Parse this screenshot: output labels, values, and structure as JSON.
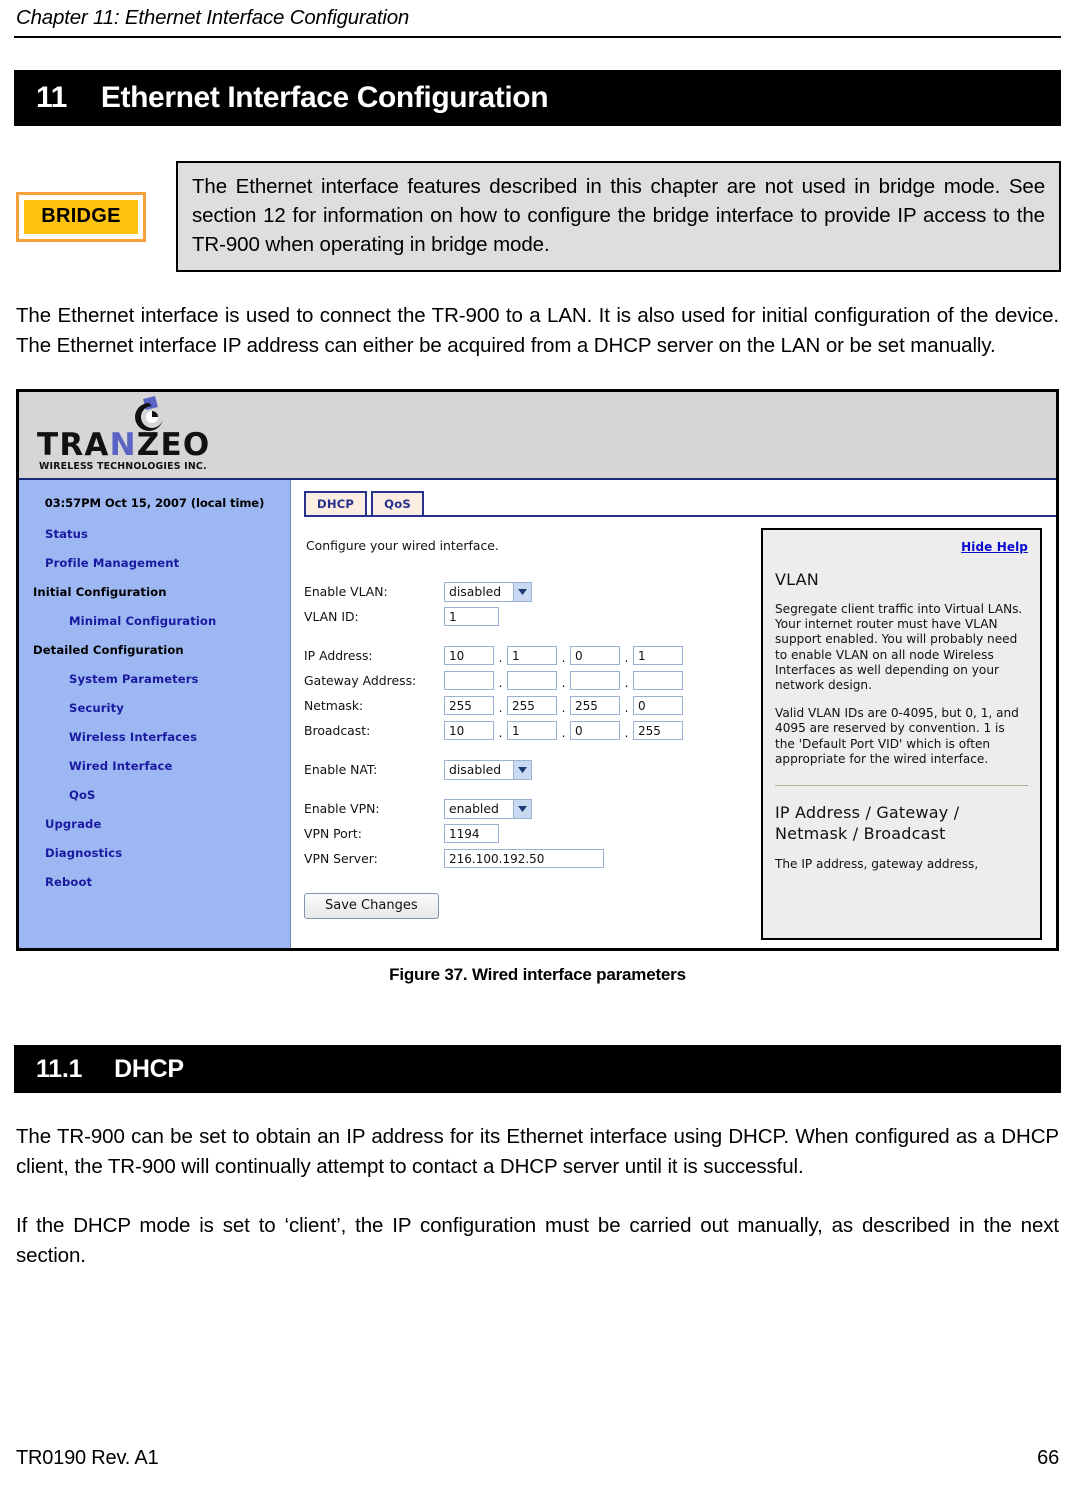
{
  "running_header": "Chapter 11: Ethernet Interface Configuration",
  "chapter": {
    "number": "11",
    "title": "Ethernet Interface Configuration"
  },
  "bridge_note": {
    "badge_label": "BRIDGE",
    "text": "The Ethernet interface features described in this chapter are not used in bridge mode. See section 12 for information on how to configure the bridge interface to provide IP access to the TR-900 when operating in bridge mode.",
    "badge_border_color": "#F5A03C",
    "badge_fill_color": "#FFC20E",
    "box_background": "#DEDEDE"
  },
  "intro_paragraph": "The Ethernet interface is used to connect the TR-900 to a LAN. It is also used for initial configuration of the device. The Ethernet interface IP address can either be acquired from a DHCP server on the LAN or be set manually.",
  "screenshot": {
    "logo": {
      "wordmark_pre": "TRA",
      "wordmark_n": "N",
      "wordmark_post": "ZEO",
      "tagline": "WIRELESS  TECHNOLOGIES INC.",
      "accent_color": "#5B63C4",
      "header_background": "#D6D6D6"
    },
    "sidebar": {
      "background": "#9DB7F3",
      "link_color": "#1A1AA0",
      "timestamp": "03:57PM Oct 15, 2007 (local time)",
      "items": [
        {
          "label": "Status",
          "type": "link"
        },
        {
          "label": "Profile Management",
          "type": "link"
        },
        {
          "label": "Initial Configuration",
          "type": "header"
        },
        {
          "label": "Minimal Configuration",
          "type": "sublink"
        },
        {
          "label": "Detailed Configuration",
          "type": "header"
        },
        {
          "label": "System Parameters",
          "type": "sublink"
        },
        {
          "label": "Security",
          "type": "sublink"
        },
        {
          "label": "Wireless Interfaces",
          "type": "sublink"
        },
        {
          "label": "Wired Interface",
          "type": "sublink"
        },
        {
          "label": "QoS",
          "type": "sublink"
        },
        {
          "label": "Upgrade",
          "type": "link"
        },
        {
          "label": "Diagnostics",
          "type": "link"
        },
        {
          "label": "Reboot",
          "type": "link"
        }
      ]
    },
    "tabs": [
      {
        "label": "DHCP"
      },
      {
        "label": "QoS"
      }
    ],
    "tab_accent_color": "#27318C",
    "intro_line": "Configure your wired interface.",
    "form": {
      "enable_vlan_label": "Enable VLAN:",
      "enable_vlan_value": "disabled",
      "vlan_id_label": "VLAN ID:",
      "vlan_id_value": "1",
      "ip_address_label": "IP Address:",
      "ip_address_octets": [
        "10",
        "1",
        "0",
        "1"
      ],
      "gateway_label": "Gateway Address:",
      "gateway_octets": [
        "",
        "",
        "",
        ""
      ],
      "netmask_label": "Netmask:",
      "netmask_octets": [
        "255",
        "255",
        "255",
        "0"
      ],
      "broadcast_label": "Broadcast:",
      "broadcast_octets": [
        "10",
        "1",
        "0",
        "255"
      ],
      "enable_nat_label": "Enable NAT:",
      "enable_nat_value": "disabled",
      "enable_vpn_label": "Enable VPN:",
      "enable_vpn_value": "enabled",
      "vpn_port_label": "VPN Port:",
      "vpn_port_value": "1194",
      "vpn_server_label": "VPN Server:",
      "vpn_server_value": "216.100.192.50",
      "save_button_label": "Save Changes",
      "separator": "."
    },
    "help": {
      "hide_link": "Hide Help",
      "section1_title": "VLAN",
      "section1_p1": "Segregate client traffic into Virtual LANs. Your internet router must have VLAN support enabled. You will probably need to enable VLAN on all node Wireless Interfaces as well depending on your network design.",
      "section1_p2": "Valid VLAN IDs are 0-4095, but 0, 1, and 4095 are reserved by convention. 1 is the 'Default Port VID' which is often appropriate for the wired interface.",
      "section2_title": "IP Address / Gateway / Netmask / Broadcast",
      "section2_p1": "The IP address, gateway address,"
    }
  },
  "figure_caption": "Figure 37. Wired interface parameters",
  "subsection": {
    "number": "11.1",
    "title": "DHCP"
  },
  "dhcp_paragraph_1": "The TR-900 can be set to obtain an IP address for its Ethernet interface using DHCP. When configured as a DHCP client, the TR-900 will continually attempt to contact a DHCP server until it is successful.",
  "dhcp_paragraph_2": "If the DHCP mode is set to ‘client’, the IP configuration must be carried out manually, as described in the next section.",
  "footer": {
    "document_id": "TR0190 Rev. A1",
    "page_number": "66"
  }
}
